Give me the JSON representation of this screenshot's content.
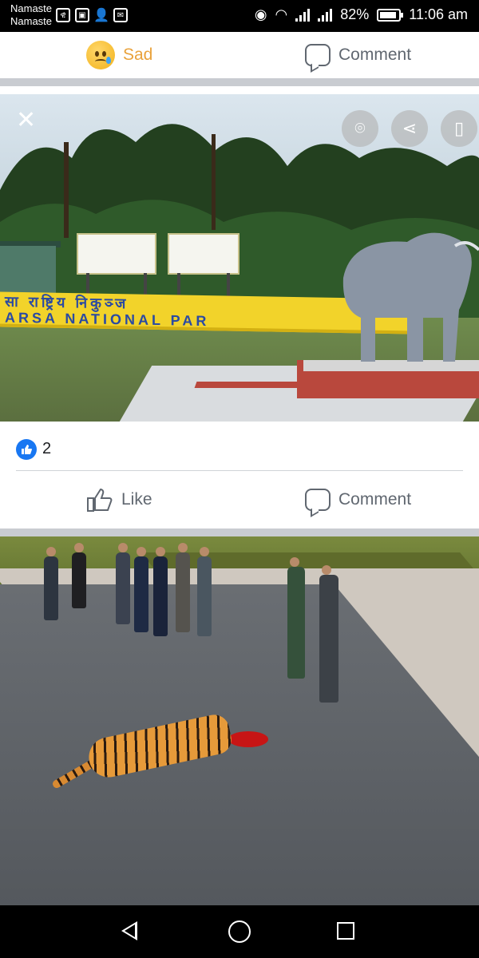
{
  "status_bar": {
    "carrier_line1": "Namaste",
    "carrier_line2": "Namaste",
    "battery_percent": "82%",
    "time": "11:06 am"
  },
  "top_actions": {
    "reaction_label": "Sad",
    "comment_label": "Comment"
  },
  "photo1": {
    "banner_text_line1": "सा  राष्ट्रिय  निकुञ्ज",
    "banner_text_line2": "ARSA  NATIONAL  PAR",
    "buttons": [
      "close-icon",
      "lens-icon",
      "share-icon",
      "bookmark-icon"
    ]
  },
  "post": {
    "like_count": "2",
    "like_label": "Like",
    "comment_label": "Comment"
  },
  "colors": {
    "accent_blue": "#1877f2",
    "sad_color": "#e9a23b",
    "action_gray": "#606770"
  },
  "navbar": {
    "buttons": [
      "back-icon",
      "home-icon",
      "recents-icon"
    ]
  }
}
